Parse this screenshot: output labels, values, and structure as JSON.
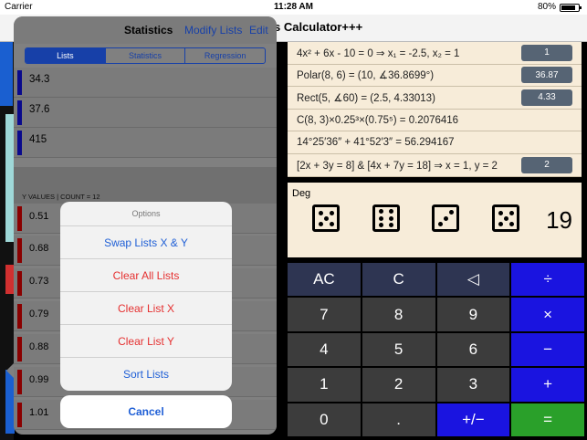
{
  "status_bar": {
    "carrier": "Carrier",
    "time": "11:28 AM",
    "battery": "80%"
  },
  "app_title": "s Calculator+++",
  "results": [
    {
      "expr": "4x² + 6x - 10 = 0     ⇒     x₁ = -2.5, x₂ = 1",
      "badge": "1"
    },
    {
      "expr": "Polar(8, 6) = (10, ∡36.8699°)",
      "badge": "36.87"
    },
    {
      "expr": "Rect(5, ∡60) = (2.5, 4.33013)",
      "badge": "4.33"
    },
    {
      "expr": "C(8, 3)×0.25³×(0.75⁵) = 0.2076416",
      "badge": ""
    },
    {
      "expr": "14°25′36″ + 41°52′3″ = 56.294167",
      "badge": ""
    },
    {
      "expr": "[2x + 3y = 8]  &  [4x + 7y = 18] ⇒ x = 1, y = 2",
      "badge": "2"
    }
  ],
  "dice": {
    "mode": "Deg",
    "values": [
      5,
      6,
      3,
      5
    ],
    "sum": "19"
  },
  "keypad": {
    "keys": [
      "AC",
      "C",
      "◁",
      "÷",
      "7",
      "8",
      "9",
      "×",
      "4",
      "5",
      "6",
      "−",
      "1",
      "2",
      "3",
      "+",
      "0",
      ".",
      "+/−",
      "="
    ]
  },
  "stats": {
    "title": "Statistics",
    "modify_label": "Modify Lists",
    "edit_label": "Edit",
    "tabs": [
      "Lists",
      "Statistics",
      "Regression"
    ],
    "active_tab": "Lists",
    "x_values": [
      "34.3",
      "37.6",
      "415"
    ],
    "y_header": "Y VALUES | COUNT = 12",
    "y_values": [
      "0.51",
      "0.68",
      "0.73",
      "0.79",
      "0.88",
      "0.99",
      "1.01"
    ]
  },
  "action_sheet": {
    "title": "Options",
    "items": [
      {
        "label": "Swap Lists X & Y",
        "style": "blue"
      },
      {
        "label": "Clear All Lists",
        "style": "red"
      },
      {
        "label": "Clear List X",
        "style": "red"
      },
      {
        "label": "Clear List Y",
        "style": "red"
      },
      {
        "label": "Sort Lists",
        "style": "blue"
      }
    ],
    "cancel": "Cancel"
  }
}
